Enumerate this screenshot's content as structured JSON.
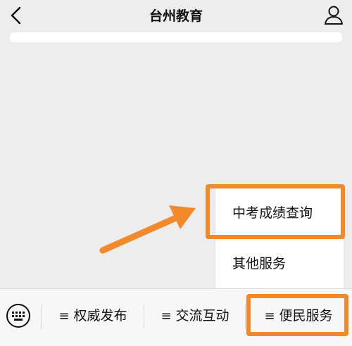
{
  "header": {
    "title": "台州教育",
    "back_icon": "chevron-left-icon",
    "profile_icon": "person-icon"
  },
  "popup": {
    "items": [
      {
        "label": "中考成绩查询",
        "highlighted": true
      },
      {
        "label": "其他服务",
        "highlighted": false
      }
    ]
  },
  "bottom_menu": {
    "keyboard_icon": "keyboard-icon",
    "menu_glyph": "≡",
    "items": [
      {
        "label": "权威发布"
      },
      {
        "label": "交流互动"
      },
      {
        "label": "便民服务",
        "highlighted": true
      }
    ]
  },
  "colors": {
    "highlight": "#f28a2c",
    "background": "#ededed",
    "bar_background": "#f7f7f7",
    "popup_background": "#ffffff"
  }
}
